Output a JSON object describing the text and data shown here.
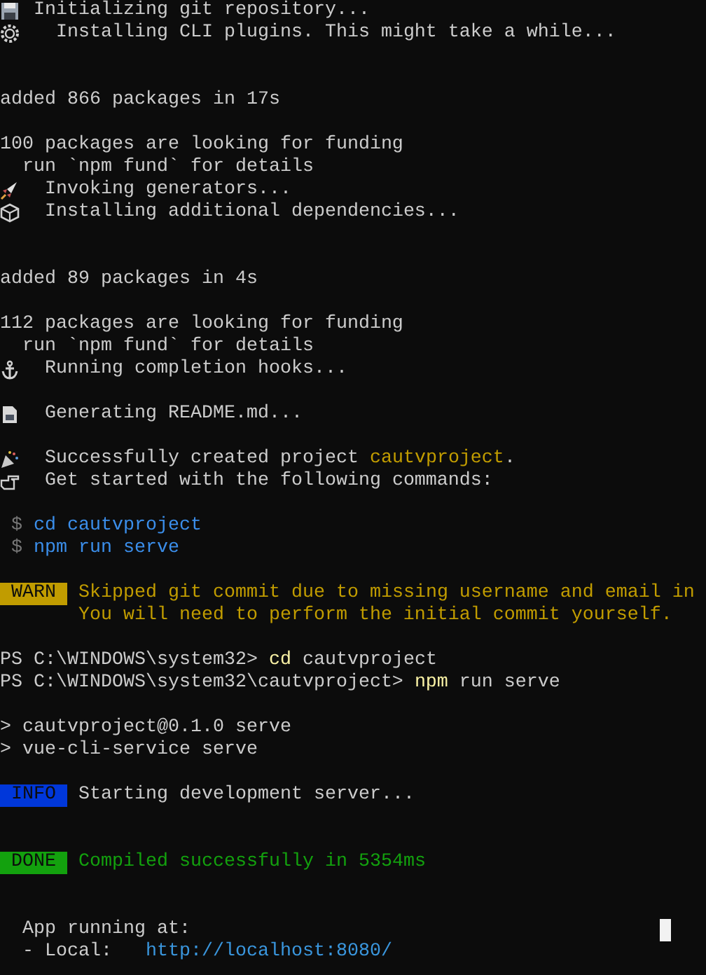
{
  "terminal": {
    "lines": [
      {
        "kind": "text",
        "segments": [
          {
            "kind": "floppy"
          },
          {
            "kind": "text",
            "text": " Initializing git repository...",
            "color": "#cccccc"
          }
        ]
      },
      {
        "kind": "text",
        "segments": [
          {
            "kind": "gear"
          },
          {
            "kind": "text",
            "text": "   Installing CLI plugins. This might take a while...",
            "color": "#cccccc"
          }
        ]
      },
      {
        "kind": "blank"
      },
      {
        "kind": "blank"
      },
      {
        "kind": "text",
        "segments": [
          {
            "kind": "text",
            "text": "added 866 packages in 17s",
            "color": "#cccccc"
          }
        ]
      },
      {
        "kind": "blank"
      },
      {
        "kind": "text",
        "segments": [
          {
            "kind": "text",
            "text": "100 packages are looking for funding",
            "color": "#cccccc"
          }
        ]
      },
      {
        "kind": "text",
        "segments": [
          {
            "kind": "text",
            "text": "  run `npm fund` for details",
            "color": "#cccccc"
          }
        ]
      },
      {
        "kind": "text",
        "segments": [
          {
            "kind": "rocket"
          },
          {
            "kind": "text",
            "text": "  Invoking generators...",
            "color": "#cccccc"
          }
        ]
      },
      {
        "kind": "text",
        "segments": [
          {
            "kind": "package"
          },
          {
            "kind": "text",
            "text": "  Installing additional dependencies...",
            "color": "#cccccc"
          }
        ]
      },
      {
        "kind": "blank"
      },
      {
        "kind": "blank"
      },
      {
        "kind": "text",
        "segments": [
          {
            "kind": "text",
            "text": "added 89 packages in 4s",
            "color": "#cccccc"
          }
        ]
      },
      {
        "kind": "blank"
      },
      {
        "kind": "text",
        "segments": [
          {
            "kind": "text",
            "text": "112 packages are looking for funding",
            "color": "#cccccc"
          }
        ]
      },
      {
        "kind": "text",
        "segments": [
          {
            "kind": "text",
            "text": "  run `npm fund` for details",
            "color": "#cccccc"
          }
        ]
      },
      {
        "kind": "text",
        "segments": [
          {
            "kind": "anchor"
          },
          {
            "kind": "text",
            "text": "  Running completion hooks...",
            "color": "#cccccc"
          }
        ]
      },
      {
        "kind": "blank"
      },
      {
        "kind": "text",
        "segments": [
          {
            "kind": "document"
          },
          {
            "kind": "text",
            "text": "  Generating README.md...",
            "color": "#cccccc"
          }
        ]
      },
      {
        "kind": "blank"
      },
      {
        "kind": "text",
        "segments": [
          {
            "kind": "party"
          },
          {
            "kind": "text",
            "text": "  Successfully created project ",
            "color": "#cccccc"
          },
          {
            "kind": "text",
            "text": "cautvproject",
            "color": "#c19c00"
          },
          {
            "kind": "text",
            "text": ".",
            "color": "#cccccc"
          }
        ]
      },
      {
        "kind": "text",
        "segments": [
          {
            "kind": "hand"
          },
          {
            "kind": "text",
            "text": "  Get started with the following commands:",
            "color": "#cccccc"
          }
        ]
      },
      {
        "kind": "blank"
      },
      {
        "kind": "text",
        "segments": [
          {
            "kind": "text",
            "text": " $",
            "color": "#767676"
          },
          {
            "kind": "text",
            "text": " cd cautvproject",
            "color": "#3b8eea"
          }
        ]
      },
      {
        "kind": "text",
        "segments": [
          {
            "kind": "text",
            "text": " $",
            "color": "#767676"
          },
          {
            "kind": "text",
            "text": " npm run serve",
            "color": "#3b8eea"
          }
        ]
      },
      {
        "kind": "blank"
      },
      {
        "kind": "text",
        "segments": [
          {
            "kind": "badge",
            "text": "WARN",
            "color": "#c19c00"
          },
          {
            "kind": "text",
            "text": " Skipped git commit due to missing username and email in",
            "color": "#c19c00"
          }
        ]
      },
      {
        "kind": "text",
        "segments": [
          {
            "kind": "text",
            "text": "       You will need to perform the initial commit yourself.",
            "color": "#c19c00"
          }
        ]
      },
      {
        "kind": "blank"
      },
      {
        "kind": "text",
        "segments": [
          {
            "kind": "text",
            "text": "PS C:\\WINDOWS\\system32> ",
            "color": "#cccccc"
          },
          {
            "kind": "text",
            "text": "cd",
            "color": "#f9f1a5"
          },
          {
            "kind": "text",
            "text": " cautvproject",
            "color": "#cccccc"
          }
        ]
      },
      {
        "kind": "text",
        "segments": [
          {
            "kind": "text",
            "text": "PS C:\\WINDOWS\\system32\\cautvproject> ",
            "color": "#cccccc"
          },
          {
            "kind": "text",
            "text": "npm",
            "color": "#f9f1a5"
          },
          {
            "kind": "text",
            "text": " run serve",
            "color": "#cccccc"
          }
        ]
      },
      {
        "kind": "blank"
      },
      {
        "kind": "text",
        "segments": [
          {
            "kind": "text",
            "text": "> cautvproject@0.1.0 serve",
            "color": "#cccccc"
          }
        ]
      },
      {
        "kind": "text",
        "segments": [
          {
            "kind": "text",
            "text": "> vue-cli-service serve",
            "color": "#cccccc"
          }
        ]
      },
      {
        "kind": "blank"
      },
      {
        "kind": "text",
        "segments": [
          {
            "kind": "badge",
            "text": "INFO",
            "color": "#0037da"
          },
          {
            "kind": "text",
            "text": " Starting development server...",
            "color": "#cccccc"
          }
        ]
      },
      {
        "kind": "blank"
      },
      {
        "kind": "blank"
      },
      {
        "kind": "text",
        "segments": [
          {
            "kind": "badge",
            "text": "DONE",
            "color": "#13a10e"
          },
          {
            "kind": "text",
            "text": " Compiled successfully in 5354ms",
            "color": "#13a10e"
          }
        ]
      },
      {
        "kind": "blank"
      },
      {
        "kind": "blank"
      },
      {
        "kind": "text",
        "segments": [
          {
            "kind": "text",
            "text": "  App running at:",
            "color": "#cccccc"
          },
          {
            "kind": "cursor"
          }
        ]
      },
      {
        "kind": "text",
        "segments": [
          {
            "kind": "text",
            "text": "  - Local:   ",
            "color": "#cccccc"
          },
          {
            "kind": "link",
            "text": "http://localhost:8080/",
            "color": "#3a96dd"
          }
        ]
      }
    ]
  }
}
